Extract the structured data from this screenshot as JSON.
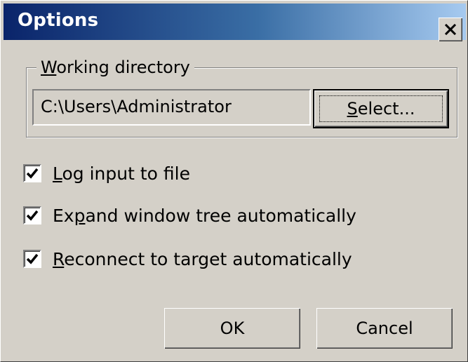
{
  "window": {
    "title": "Options",
    "close_label": "Close"
  },
  "working_directory": {
    "legend_pre": "",
    "legend_mnemonic": "W",
    "legend_post": "orking directory",
    "path": "C:\\Users\\Administrator",
    "select_pre": "",
    "select_mnemonic": "S",
    "select_post": "elect..."
  },
  "options": [
    {
      "pre": "",
      "mnemonic": "L",
      "post": "og input to file",
      "checked": true
    },
    {
      "pre": "Ex",
      "mnemonic": "p",
      "post": "and window tree automatically",
      "checked": true
    },
    {
      "pre": "",
      "mnemonic": "R",
      "post": "econnect to target automatically",
      "checked": true
    }
  ],
  "buttons": {
    "ok": "OK",
    "cancel": "Cancel"
  },
  "icons": {
    "close": "close-icon",
    "check": "checkmark-icon"
  }
}
